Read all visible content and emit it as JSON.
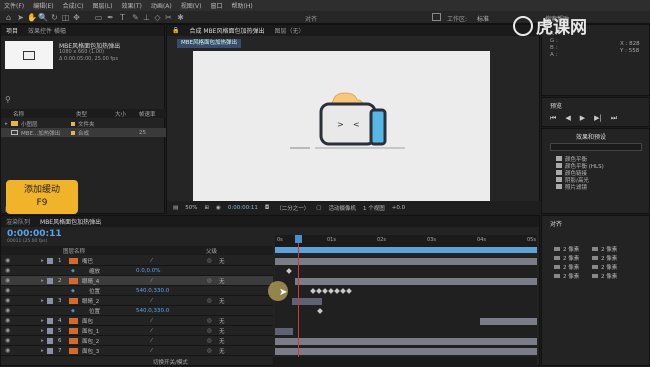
{
  "menu": [
    "文件(F)",
    "编辑(E)",
    "合成(C)",
    "图层(L)",
    "效果(T)",
    "动画(A)",
    "视图(V)",
    "窗口",
    "帮助(H)"
  ],
  "toolbar_right": {
    "align": "对齐",
    "workspace_label": "工作区:",
    "workspace_value": "标准",
    "search": "搜索帮助"
  },
  "watermark": "虎课网",
  "project": {
    "tab": "项目",
    "effects_tab": "效果控件 横幅",
    "comp_name": "MBE风格面包加热弹出",
    "comp_info1": "1080 x 660 (1.00)",
    "comp_info2": "Δ 0:00:05:00, 25.00 fps",
    "columns": {
      "name": "名称",
      "type": "类型",
      "size": "大小",
      "rate": "帧速率"
    },
    "items": [
      {
        "name": "小图层",
        "type": "文件夹",
        "size": "",
        "rate": ""
      },
      {
        "name": "MBE...加热弹出",
        "type": "合成",
        "size": "",
        "rate": "25"
      }
    ]
  },
  "badge": {
    "title": "添加缓动",
    "key": "F9"
  },
  "composition": {
    "tab": "合成 MBE风格面包加热弹出",
    "layer_tab": "图层（无）",
    "crumb": "MBE风格面包加热弹出",
    "zoom": "50%",
    "time": "0:00:00:11",
    "res": "（二分之一）",
    "camera": "活动摄像机",
    "views": "1 个视图",
    "offset": "+0.0"
  },
  "info": {
    "r": "R :",
    "g": "G :",
    "b": "B :",
    "a": "A :",
    "x": "X : 828",
    "y": "Y : 558"
  },
  "preview": {
    "title": "预览"
  },
  "effects": {
    "title": "效果和预设",
    "search": "",
    "items": [
      "颜色平衡",
      "颜色平衡 (HLS)",
      "颜色链接",
      "阴影/高光",
      "照片滤镜"
    ]
  },
  "align_panel": {
    "title": "对齐",
    "items": [
      "2 像素",
      "2 像素",
      "2 像素",
      "2 像素"
    ],
    "items2": [
      "2 像素",
      "2 像素",
      "2 像素",
      "2 像素"
    ]
  },
  "timeline": {
    "tab_render": "渲染队列",
    "tab_comp": "MBE风格面包加热弹出",
    "time": "0:00:00:11",
    "fps": "00011 (25.00 fps)",
    "col_name": "图层名称",
    "col_parent": "父级",
    "ruler": [
      "0s",
      "01s",
      "02s",
      "03s",
      "04s",
      "05s"
    ],
    "layers": [
      {
        "num": "1",
        "name": "嘴巴",
        "parent": "无",
        "kind": "layer"
      },
      {
        "num": "",
        "name": "缩放",
        "value": "0.0,0.0%",
        "kind": "prop"
      },
      {
        "num": "2",
        "name": "眼睛_4",
        "parent": "无",
        "kind": "layer"
      },
      {
        "num": "",
        "name": "位置",
        "value": "540.0,330.0",
        "kind": "prop"
      },
      {
        "num": "3",
        "name": "眼睛_2",
        "parent": "无",
        "kind": "layer"
      },
      {
        "num": "",
        "name": "位置",
        "value": "540.0,330.0",
        "kind": "prop"
      },
      {
        "num": "4",
        "name": "面包",
        "parent": "无",
        "kind": "layer"
      },
      {
        "num": "5",
        "name": "面包_1",
        "parent": "无",
        "kind": "layer"
      },
      {
        "num": "6",
        "name": "面包_2",
        "parent": "无",
        "kind": "layer"
      },
      {
        "num": "7",
        "name": "面包_3",
        "parent": "无",
        "kind": "layer"
      }
    ],
    "footer": "切换开关/模式"
  },
  "colors": {
    "accent": "#4a8fd0",
    "badge": "#f0b32a",
    "toast_body": "#e9e9e9",
    "toast_outline": "#2a2f3a",
    "toast_handle": "#56b8e6",
    "bread": "#f7c77a"
  }
}
